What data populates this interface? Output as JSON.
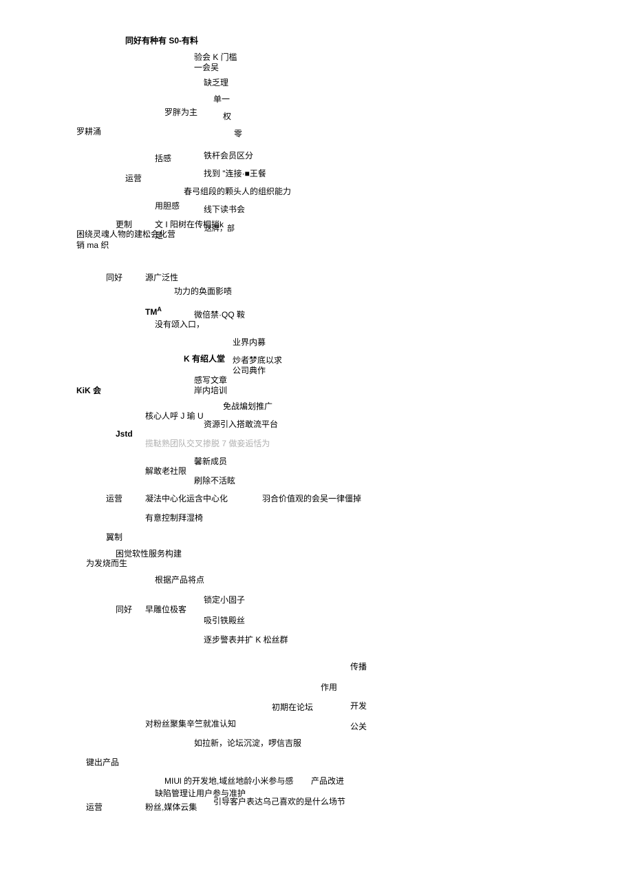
{
  "t1": "同好有种有 S0-有料",
  "t2": "验会 K 门槛",
  "t3": "一会吴",
  "t4": "缺乏理",
  "t5": "单一",
  "t6": "罗胖为主",
  "t7": "权",
  "t8": "罗耕涌",
  "t9": "零",
  "t10": "铁杆会员区分",
  "t11": "括感",
  "t12": "找到 \"连接·■王餐",
  "t13": "运营",
  "t14": "春弓组段的颗头人的组织能力",
  "t15": "用胆感",
  "t16": "线下读书会",
  "t17": "更制",
  "t18": "文 I 阳树在传桐捎k ",
  "t18b": "送牌，部",
  "t19": "困绕灵魂人物的建松会化营",
  "t20": "足",
  "t21": "销 ma 织",
  "t22": "同好",
  "t23": "源广泛性",
  "t24": "功力的奂面影啧",
  "t25a": "TM",
  "t25b": "A",
  "t26": "微倍禁·QQ 鞍",
  "t27": "没有颂入口，",
  "t28": "业界内募",
  "t29": "K 有绍人堂",
  "t30": "炒者梦底以求",
  "t31": "公司典作",
  "t32": "感写文章",
  "t33": "岸内培训",
  "t34": "KiK 会",
  "t35": "免战煸划推广",
  "t36": "核心人呼 J 瑜 U",
  "t37": "资源引入搭敢流平台",
  "t38": "Jstd",
  "t39": "揽鞑熟团队交叉掺脱 7 做妾逅恬为",
  "t40": "馨新成员",
  "t41": "解敢老社限",
  "t42": "刷除不活眩",
  "t43": "运营",
  "t44": "凝法中心化运含中心化",
  "t45": "羽合价值观的会吴一律僵掉",
  "t46": "有意控制拜湿椅",
  "t47": "翼制",
  "t48": "困觉软性服务构建",
  "t49": "为发烧而生",
  "t50": "根据产品将点",
  "t51": "锁定小固子",
  "t52": "同好",
  "t53": "早雕位极客",
  "t54": "吸引铁殿丝",
  "t55": "逐步警表并扩 K 松丝群",
  "t56": "传播",
  "t57": "作用",
  "t58": "初期在论坛",
  "t59": "开发",
  "t60": "对粉丝聚集辛竺就准认知",
  "t61": "公关",
  "t62": "如拉新，论坛沉淀，啰信吉服",
  "t63": "键出产品",
  "t64": "MIUl 的开发地,域丝地龄小米参与感",
  "t65": "产品改进",
  "t66": "缺陷管理让用户参与准护",
  "t67": "引导客户表达乌己喜欢的是什么场节",
  "t68": "运营",
  "t69": "粉丝,媒体云集"
}
